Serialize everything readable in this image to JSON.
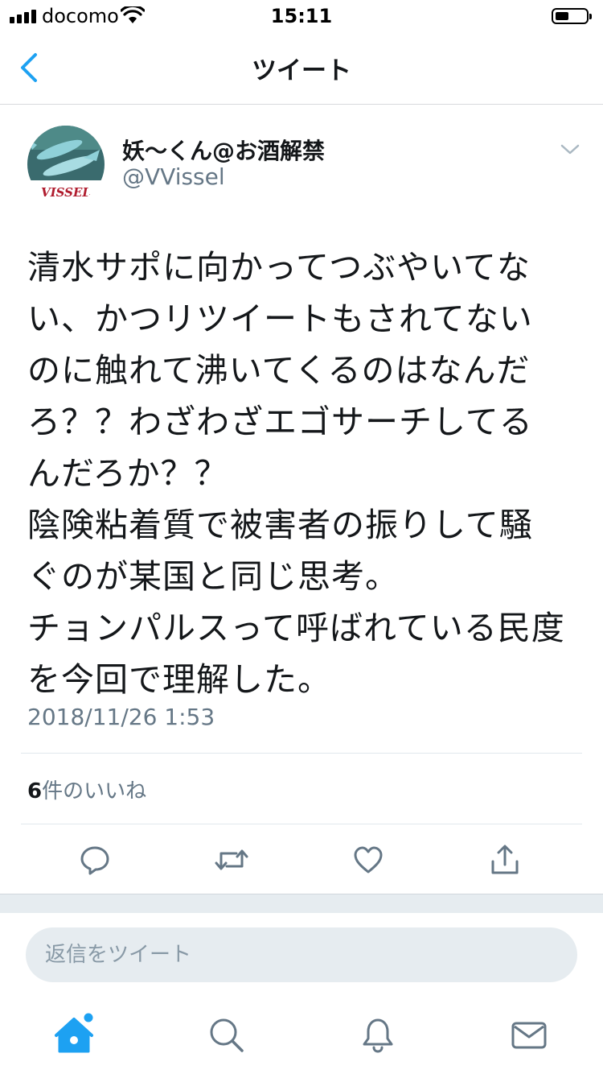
{
  "status_bar": {
    "carrier": "docomo",
    "time": "15:11",
    "battery_level": 0.45
  },
  "nav": {
    "title": "ツイート",
    "back_icon": "chevron-left-icon"
  },
  "tweet": {
    "avatar_text": "VISSEL",
    "display_name": "妖〜くん@お酒解禁",
    "handle": "@VVissel",
    "text": "清水サポに向かってつぶやいてない、かつリツイートもされてないのに触れて沸いてくるのはなんだろ？？わざわざエゴサーチしてるんだろか？？\n陰険粘着質で被害者の振りして騒ぐのが某国と同じ思考。\nチョンパルスって呼ばれている民度を今回で理解した。",
    "timestamp": "2018/11/26 1:53",
    "likes_count": "6",
    "likes_label": "件のいいね"
  },
  "actions": [
    "reply-icon",
    "retweet-icon",
    "like-icon",
    "share-icon"
  ],
  "reply": {
    "placeholder": "返信をツイート"
  },
  "tab_bar": {
    "items": [
      "home-icon",
      "search-icon",
      "notifications-icon",
      "messages-icon"
    ],
    "active": "home-icon"
  },
  "colors": {
    "accent": "#1da1f2",
    "text": "#14171a",
    "secondary": "#657786",
    "divider": "#e1e8ed",
    "band": "#e6ecf0",
    "avatar_text": "#b01c2e"
  }
}
